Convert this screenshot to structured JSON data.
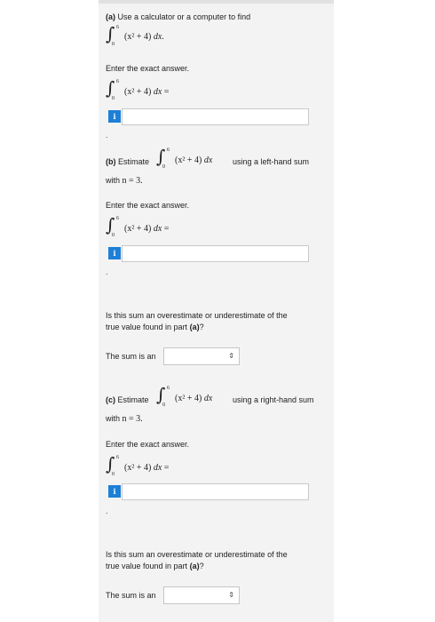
{
  "part_a": {
    "label": "(a)",
    "instruction": "Use a calculator or a computer to find",
    "exact_prompt": "Enter the exact answer.",
    "info_icon": "i"
  },
  "part_b": {
    "label": "(b)",
    "estimate_word": "Estimate",
    "suffix": "using a left-hand sum",
    "with_n": "with",
    "exact_prompt": "Enter the exact answer.",
    "info_icon": "i",
    "question_line1": "Is this sum an overestimate or underestimate of the",
    "question_line2_prefix": "true value found in part",
    "question_part_ref": "(a)",
    "question_mark": "?",
    "sum_label": "The sum is an",
    "select_value": ""
  },
  "part_c": {
    "label": "(c)",
    "estimate_word": "Estimate",
    "suffix": "using a right-hand sum",
    "with_n": "with",
    "exact_prompt": "Enter the exact answer.",
    "info_icon": "i",
    "question_line1": "Is this sum an overestimate or underestimate of the",
    "question_line2_prefix": "true value found in part",
    "question_part_ref": "(a)",
    "question_mark": "?",
    "sum_label": "The sum is an",
    "select_value": ""
  },
  "math": {
    "integral_sign": "∫",
    "upper_limit": "6",
    "lower_limit": "0",
    "integrand": "(x² + 4)",
    "dx": "dx",
    "period": ".",
    "equals": "=",
    "n_expr": "n = 3."
  },
  "icons": {
    "info": "info-icon",
    "select_arrows": "updown-chevron-icon"
  },
  "colors": {
    "panel_bg": "#f3f3f3",
    "info_blue": "#1e7fd6"
  }
}
